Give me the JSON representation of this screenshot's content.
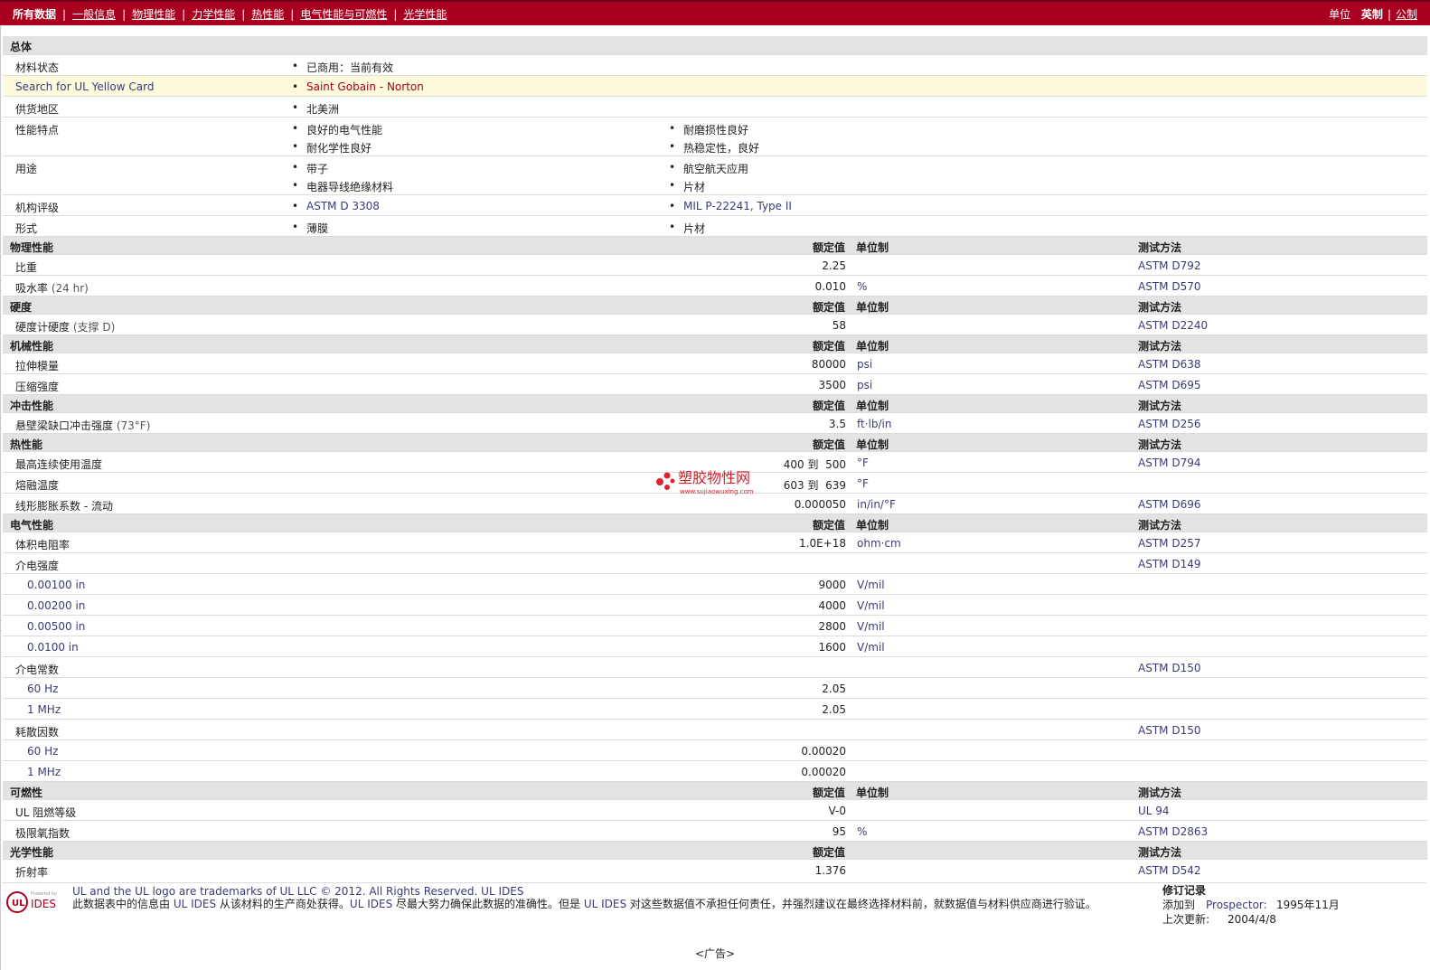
{
  "topbar": {
    "tabs": [
      "所有数据",
      "一般信息",
      "物理性能",
      "力学性能",
      "热性能",
      "电气性能与可燃性",
      "光学性能"
    ],
    "units_label": "单位",
    "unit_current": "英制",
    "unit_other": "公制"
  },
  "general": {
    "title": "总体",
    "status_label": "材料状态",
    "status_value": "已商用：当前有效",
    "yellowcard_label": "Search for UL Yellow Card",
    "yellowcard_value": "Saint Gobain - Norton",
    "region_label": "供货地区",
    "region_value": "北美洲",
    "features_label": "性能特点",
    "features": [
      "良好的电气性能",
      "耐磨损性良好",
      "耐化学性良好",
      "热稳定性，良好"
    ],
    "uses_label": "用途",
    "uses": [
      "带子",
      "航空航天应用",
      "电器导线绝缘材料",
      "片材"
    ],
    "ratings_label": "机构评级",
    "ratings": [
      "ASTM D 3308",
      "MIL P-22241, Type II"
    ],
    "forms_label": "形式",
    "forms": [
      "薄膜",
      "片材"
    ]
  },
  "headers": {
    "value": "额定值",
    "unit": "单位制",
    "method": "测试方法"
  },
  "physical": {
    "title": "物理性能",
    "rows": [
      {
        "label": "比重",
        "cond": "",
        "value": "2.25",
        "unit": "",
        "method": "ASTM D792"
      },
      {
        "label": "吸水率",
        "cond": "(24 hr)",
        "value": "0.010",
        "unit": "%",
        "method": "ASTM D570"
      }
    ]
  },
  "hardness": {
    "title": "硬度",
    "rows": [
      {
        "label": "硬度计硬度",
        "cond": "(支撑 D)",
        "value": "58",
        "unit": "",
        "method": "ASTM D2240"
      }
    ]
  },
  "mechanical": {
    "title": "机械性能",
    "rows": [
      {
        "label": "拉伸模量",
        "cond": "",
        "value": "80000",
        "unit": "psi",
        "method": "ASTM D638"
      },
      {
        "label": "压缩强度",
        "cond": "",
        "value": "3500",
        "unit": "psi",
        "method": "ASTM D695"
      }
    ]
  },
  "impact": {
    "title": "冲击性能",
    "rows": [
      {
        "label": "悬壁梁缺口冲击强度",
        "cond": "(73°F)",
        "value": "3.5",
        "unit": "ft·lb/in",
        "method": "ASTM D256"
      }
    ]
  },
  "thermal": {
    "title": "热性能",
    "rows": [
      {
        "label": "最高连续使用温度",
        "cond": "",
        "value": "400 到  500",
        "unit": "°F",
        "method": "ASTM D794"
      },
      {
        "label": "熔融温度",
        "cond": "",
        "value": "603 到  639",
        "unit": "°F",
        "method": ""
      },
      {
        "label": "线形膨胀系数 - 流动",
        "cond": "",
        "value": "0.000050",
        "unit": "in/in/°F",
        "method": "ASTM D696"
      }
    ]
  },
  "electrical": {
    "title": "电气性能",
    "volume_resistivity": {
      "label": "体积电阻率",
      "value": "1.0E+18",
      "unit": "ohm·cm",
      "method": "ASTM D257"
    },
    "dielectric_strength": {
      "label": "介电强度",
      "method": "ASTM D149",
      "rows": [
        {
          "label": "0.00100 in",
          "value": "9000",
          "unit": "V/mil"
        },
        {
          "label": "0.00200 in",
          "value": "4000",
          "unit": "V/mil"
        },
        {
          "label": "0.00500 in",
          "value": "2800",
          "unit": "V/mil"
        },
        {
          "label": "0.0100 in",
          "value": "1600",
          "unit": "V/mil"
        }
      ]
    },
    "dielectric_constant": {
      "label": "介电常数",
      "method": "ASTM D150",
      "rows": [
        {
          "label": "60 Hz",
          "value": "2.05",
          "unit": ""
        },
        {
          "label": "1 MHz",
          "value": "2.05",
          "unit": ""
        }
      ]
    },
    "dissipation_factor": {
      "label": "耗散因数",
      "method": "ASTM D150",
      "rows": [
        {
          "label": "60 Hz",
          "value": "0.00020",
          "unit": ""
        },
        {
          "label": "1 MHz",
          "value": "0.00020",
          "unit": ""
        }
      ]
    }
  },
  "flammability": {
    "title": "可燃性",
    "rows": [
      {
        "label": "UL 阻燃等级",
        "cond": "",
        "value": "V-0",
        "unit": "",
        "method": "UL 94"
      },
      {
        "label": "极限氧指数",
        "cond": "",
        "value": "95",
        "unit": "%",
        "method": "ASTM D2863"
      }
    ]
  },
  "optical": {
    "title": "光学性能",
    "rows": [
      {
        "label": "折射率",
        "cond": "",
        "value": "1.376",
        "unit": "",
        "method": "ASTM D542"
      }
    ]
  },
  "footer": {
    "logo_powered": "Powered by",
    "logo_ides": "IDES",
    "logo_ul": "UL",
    "line1": "UL and the UL logo are trademarks of UL LLC © 2012. All Rights Reserved. UL IDES",
    "line2_a": "此数据表中的信息由 ",
    "line2_b": "UL IDES",
    "line2_c": " 从该材料的生产商处获得。",
    "line2_d": "UL IDES",
    "line2_e": " 尽最大努力确保此数据的准确性。但是 ",
    "line2_f": "UL IDES",
    "line2_g": " 对这些数据值不承担任何责任，并强烈建议在最终选择材料前，就数据值与材料供应商进行验证。",
    "revision_title": "修订记录",
    "added_label": "添加到",
    "added_source": "Prospector:",
    "added_date": "1995年11月",
    "updated_label": "上次更新:",
    "updated_date": "2004/4/8",
    "ad": "<广告>"
  },
  "watermark": {
    "name": "塑胶物性网",
    "url": "www.sujiaowuxing.com"
  },
  "colors": {
    "brand_red": "#a8001e",
    "link_blue": "#3b3b78",
    "section_gray": "#e3e3e3",
    "highlight": "#fdfbdc"
  }
}
